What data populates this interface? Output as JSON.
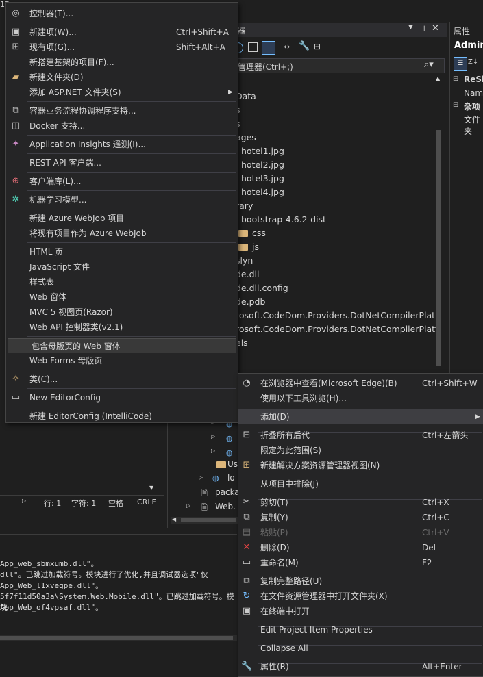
{
  "titlebar": {
    "fragment": "15"
  },
  "solution_explorer": {
    "title_fragment": "器",
    "search_placeholder": "管理器(Ctrl+;)",
    "tree": [
      "Data",
      "s",
      "s",
      "ages",
      "hotel1.jpg",
      "hotel2.jpg",
      "hotel3.jpg",
      "hotel4.jpg",
      "rary",
      "bootstrap-4.6.2-dist",
      "css",
      "js",
      "slyn",
      "de.dll",
      "de.dll.config",
      "de.pdb",
      "rosoft.CodeDom.Providers.DotNetCompilerPlatf",
      "rosoft.CodeDom.Providers.DotNetCompilerPlatf",
      "els"
    ],
    "tree_lower": [
      "Us",
      "lo",
      "packa",
      "Web."
    ]
  },
  "properties": {
    "title": "属性",
    "object": "Admin",
    "row1": "ReSh",
    "row2": "Nam",
    "cat2": "杂项",
    "row3": "文件夹"
  },
  "statusbar": {
    "line": "行: 1",
    "char": "字符: 1",
    "space": "空格",
    "crlf": "CRLF"
  },
  "output": {
    "lines": [
      "App_web_sbmxumb.dll\"。",
      "dll\"。已跳过加载符号。模块进行了优化,并且调试器选项\"仅",
      "App_Web_l1xvegpe.dll\"。",
      "5f7f11d50a3a\\System.Web.Mobile.dll\"。已跳过加载符号。模块",
      "App_Web_of4vpsaf.dll\"。"
    ]
  },
  "add_menu": {
    "items": [
      {
        "label": "控制器(T)...",
        "shortcut": "",
        "icon": "controller-icon"
      },
      {
        "label": "新建项(W)...",
        "shortcut": "Ctrl+Shift+A",
        "icon": "new-item-icon"
      },
      {
        "label": "现有项(G)...",
        "shortcut": "Shift+Alt+A",
        "icon": "existing-item-icon"
      },
      {
        "label": "新搭建基架的项目(F)...",
        "shortcut": "",
        "icon": ""
      },
      {
        "label": "新建文件夹(D)",
        "shortcut": "",
        "icon": "new-folder-icon"
      },
      {
        "label": "添加 ASP.NET 文件夹(S)",
        "shortcut": "",
        "icon": "",
        "submenu": true
      },
      {
        "label": "容器业务流程协调程序支持...",
        "shortcut": "",
        "icon": "container-icon"
      },
      {
        "label": "Docker 支持...",
        "shortcut": "",
        "icon": "docker-icon"
      },
      {
        "label": "Application Insights 遥测(I)...",
        "shortcut": "",
        "icon": "insights-icon"
      },
      {
        "label": "REST API 客户端...",
        "shortcut": "",
        "icon": ""
      },
      {
        "label": "客户端库(L)...",
        "shortcut": "",
        "icon": "client-library-icon"
      },
      {
        "label": "机器学习模型...",
        "shortcut": "",
        "icon": "ml-model-icon"
      },
      {
        "label": "新建 Azure WebJob 项目",
        "shortcut": "",
        "icon": ""
      },
      {
        "label": "将现有项目作为 Azure WebJob",
        "shortcut": "",
        "icon": ""
      },
      {
        "label": "HTML 页",
        "shortcut": "",
        "icon": ""
      },
      {
        "label": "JavaScript 文件",
        "shortcut": "",
        "icon": ""
      },
      {
        "label": "样式表",
        "shortcut": "",
        "icon": ""
      },
      {
        "label": "Web 窗体",
        "shortcut": "",
        "icon": ""
      },
      {
        "label": "MVC 5 视图页(Razor)",
        "shortcut": "",
        "icon": ""
      },
      {
        "label": "Web API 控制器类(v2.1)",
        "shortcut": "",
        "icon": ""
      },
      {
        "label": "包含母版页的 Web 窗体",
        "shortcut": "",
        "icon": ""
      },
      {
        "label": "Web Forms 母版页",
        "shortcut": "",
        "icon": ""
      },
      {
        "label": "类(C)...",
        "shortcut": "",
        "icon": "class-icon"
      },
      {
        "label": "New EditorConfig",
        "shortcut": "",
        "icon": "editorconfig-icon"
      },
      {
        "label": "新建 EditorConfig (IntelliCode)",
        "shortcut": "",
        "icon": ""
      }
    ]
  },
  "context_menu": {
    "items": [
      {
        "label": "在浏览器中查看(Microsoft Edge)(B)",
        "shortcut": "Ctrl+Shift+W"
      },
      {
        "label": "使用以下工具浏览(H)...",
        "shortcut": ""
      },
      {
        "label": "添加(D)",
        "shortcut": ""
      },
      {
        "label": "折叠所有后代",
        "shortcut": "Ctrl+左箭头"
      },
      {
        "label": "限定为此范围(S)",
        "shortcut": ""
      },
      {
        "label": "新建解决方案资源管理器视图(N)",
        "shortcut": ""
      },
      {
        "label": "从项目中排除(J)",
        "shortcut": ""
      },
      {
        "label": "剪切(T)",
        "shortcut": "Ctrl+X"
      },
      {
        "label": "复制(Y)",
        "shortcut": "Ctrl+C"
      },
      {
        "label": "粘贴(P)",
        "shortcut": "Ctrl+V"
      },
      {
        "label": "删除(D)",
        "shortcut": "Del"
      },
      {
        "label": "重命名(M)",
        "shortcut": "F2"
      },
      {
        "label": "复制完整路径(U)",
        "shortcut": ""
      },
      {
        "label": "在文件资源管理器中打开文件夹(X)",
        "shortcut": ""
      },
      {
        "label": "在终端中打开",
        "shortcut": ""
      },
      {
        "label": "Edit Project Item Properties",
        "shortcut": ""
      },
      {
        "label": "Collapse All",
        "shortcut": ""
      },
      {
        "label": "属性(R)",
        "shortcut": "Alt+Enter"
      }
    ]
  }
}
